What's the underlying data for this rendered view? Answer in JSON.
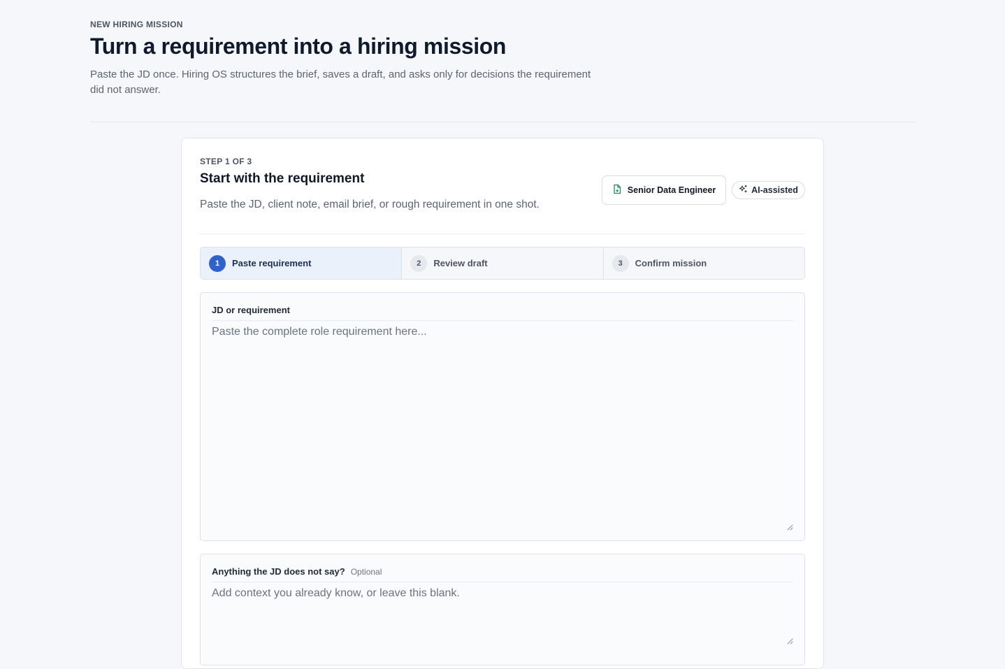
{
  "header": {
    "eyebrow": "NEW HIRING MISSION",
    "title": "Turn a requirement into a hiring mission",
    "subtitle": "Paste the JD once. Hiring OS structures the brief, saves a draft, and asks only for decisions the requirement did not answer."
  },
  "card": {
    "step_label": "STEP 1 OF 3",
    "title": "Start with the requirement",
    "description": "Paste the JD, client note, email brief, or rough requirement in one shot.",
    "role_chip": {
      "label": "Senior Data Engineer",
      "icon": "document-icon"
    },
    "ai_chip": {
      "label": "AI-assisted",
      "icon": "sparkle-icon"
    }
  },
  "stepper": {
    "steps": [
      {
        "number": "1",
        "label": "Paste requirement",
        "active": true
      },
      {
        "number": "2",
        "label": "Review draft",
        "active": false
      },
      {
        "number": "3",
        "label": "Confirm mission",
        "active": false
      }
    ]
  },
  "fields": {
    "jd": {
      "label": "JD or requirement",
      "value": "",
      "placeholder": "Paste the complete role requirement here..."
    },
    "extra": {
      "label": "Anything the JD does not say?",
      "optional_tag": "Optional",
      "value": "",
      "placeholder": "Add context you already know, or leave this blank."
    }
  },
  "colors": {
    "accent": "#2f63c9",
    "active_step_bg": "#ebf1fa",
    "page_bg": "#f5f7fa"
  }
}
